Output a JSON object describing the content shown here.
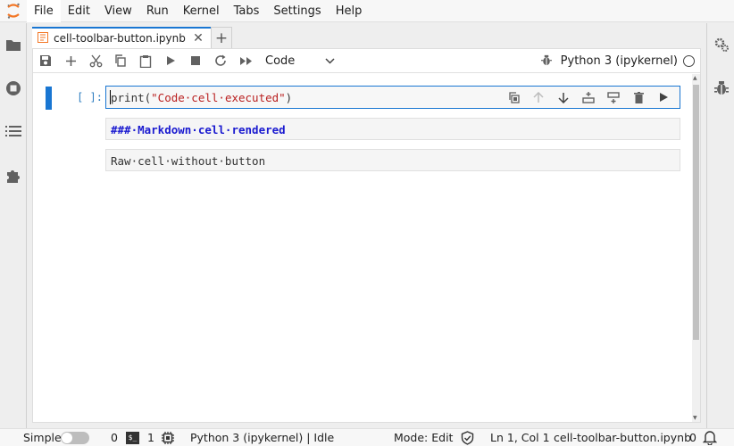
{
  "menubar": {
    "items": [
      "File",
      "Edit",
      "View",
      "Run",
      "Kernel",
      "Tabs",
      "Settings",
      "Help"
    ]
  },
  "tab": {
    "title": "cell-toolbar-button.ipynb"
  },
  "toolbar": {
    "cell_type": "Code",
    "kernel_name": "Python 3 (ipykernel)"
  },
  "cells": {
    "code": {
      "prompt": "[ ]:",
      "source": "print(\"Code·cell·executed\")"
    },
    "markdown": {
      "source": "###·Markdown·cell·rendered"
    },
    "raw": {
      "source": "Raw·cell·without·button"
    }
  },
  "statusbar": {
    "mode_label": "Simple",
    "terminals_count": "0",
    "kernels_count": "1",
    "kernel_status": "Python 3 (ipykernel) | Idle",
    "edit_mode": "Mode: Edit",
    "cursor_pos": "Ln 1, Col 1",
    "file_name": "cell-toolbar-button.ipynb",
    "notifications_count": "0"
  },
  "colors": {
    "accent": "#1976d2",
    "logo_orange": "#f37726",
    "markdown_header": "#1a1ad0",
    "string_red": "#ba2121"
  }
}
